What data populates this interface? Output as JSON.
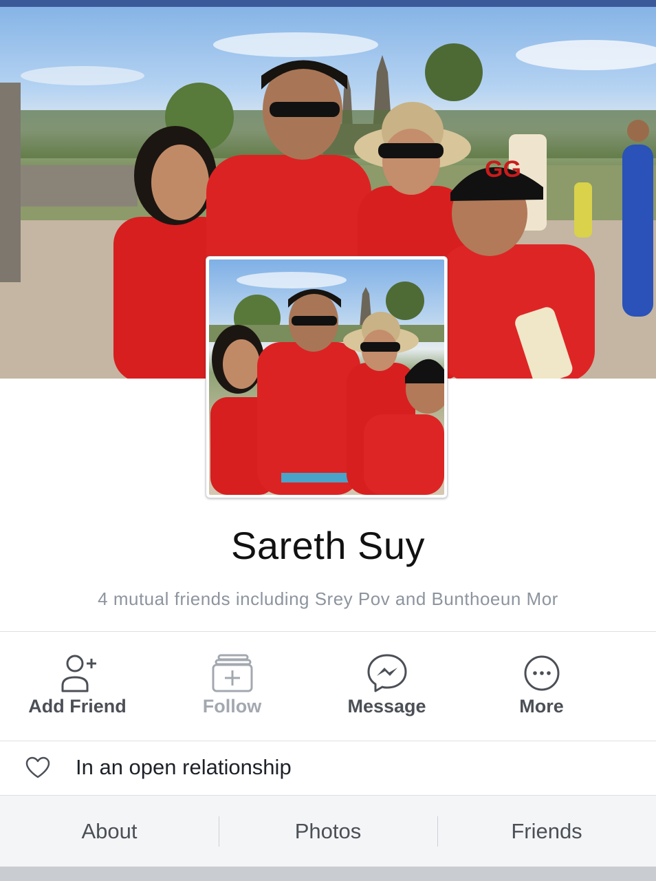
{
  "colors": {
    "brand_blue": "#3b5998",
    "text_primary": "#1d2129",
    "text_secondary": "#8d949e",
    "icon_gray": "#4b4f56",
    "disabled_gray": "#a3a8b0"
  },
  "cover_photo": {
    "description_icon": "cover-photo"
  },
  "profile": {
    "name": "Sareth Suy",
    "mutual_friends": "4 mutual friends including Srey Pov and Bunthoeun Mor"
  },
  "actions": [
    {
      "label": "Add Friend",
      "icon": "add-friend-icon",
      "enabled": true
    },
    {
      "label": "Follow",
      "icon": "follow-icon",
      "enabled": false
    },
    {
      "label": "Message",
      "icon": "messenger-icon",
      "enabled": true
    },
    {
      "label": "More",
      "icon": "more-icon",
      "enabled": true
    }
  ],
  "relationship": {
    "icon": "heart-icon",
    "text": "In an open relationship"
  },
  "tabs": [
    {
      "label": "About"
    },
    {
      "label": "Photos"
    },
    {
      "label": "Friends"
    }
  ]
}
